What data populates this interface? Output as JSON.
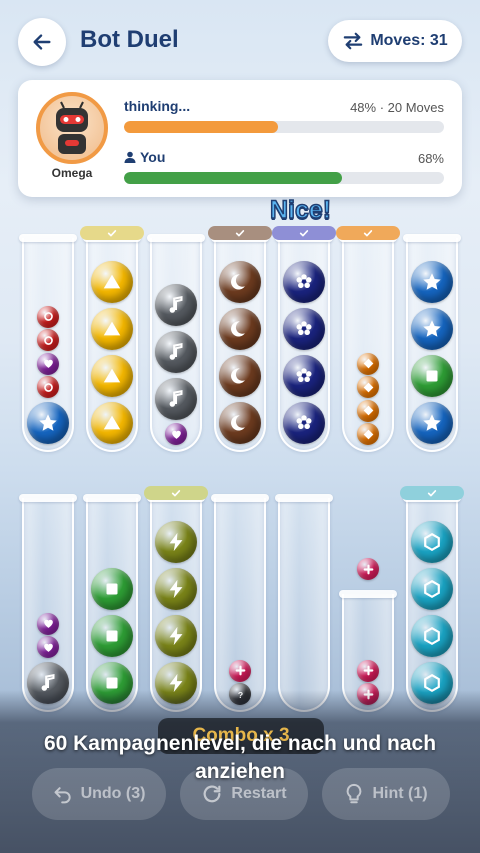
{
  "header": {
    "title": "Bot Duel",
    "moves_label": "Moves: 31"
  },
  "bot": {
    "name": "Omega",
    "status": "thinking...",
    "stats": "48% · 20 Moves",
    "progress": 48,
    "color": "#f39a3c"
  },
  "player": {
    "name": "You",
    "percent_text": "68%",
    "progress": 68,
    "color": "#43a047"
  },
  "feedback": "Nice!",
  "tubes": {
    "row1": [
      {
        "done": false,
        "balls": [
          {
            "c": "#e02020",
            "i": "ring",
            "s": "small"
          },
          {
            "c": "#e02020",
            "i": "ring",
            "s": "small"
          },
          {
            "c": "#8e24aa",
            "i": "heart",
            "s": "small"
          },
          {
            "c": "#e02020",
            "i": "ring",
            "s": "small"
          },
          {
            "c": "#1565c0",
            "i": "star",
            "s": "big"
          }
        ]
      },
      {
        "done": true,
        "cap": "#e6d98a",
        "balls": [
          {
            "c": "#f5b800",
            "i": "triangle",
            "s": "big"
          },
          {
            "c": "#f5b800",
            "i": "triangle",
            "s": "big"
          },
          {
            "c": "#f5b800",
            "i": "triangle",
            "s": "big"
          },
          {
            "c": "#f5b800",
            "i": "triangle",
            "s": "big"
          }
        ]
      },
      {
        "done": false,
        "balls": [
          {
            "c": "#555a60",
            "i": "note",
            "s": "big"
          },
          {
            "c": "#555a60",
            "i": "note",
            "s": "big"
          },
          {
            "c": "#555a60",
            "i": "note",
            "s": "big"
          },
          {
            "c": "#8e24aa",
            "i": "heart",
            "s": "small"
          }
        ]
      },
      {
        "done": true,
        "cap": "#a88f7f",
        "balls": [
          {
            "c": "#6d3b1f",
            "i": "moon",
            "s": "big"
          },
          {
            "c": "#6d3b1f",
            "i": "moon",
            "s": "big"
          },
          {
            "c": "#6d3b1f",
            "i": "moon",
            "s": "big"
          },
          {
            "c": "#6d3b1f",
            "i": "moon",
            "s": "big"
          }
        ]
      },
      {
        "done": true,
        "cap": "#8e8fd6",
        "balls": [
          {
            "c": "#1a237e",
            "i": "flower",
            "s": "big"
          },
          {
            "c": "#1a237e",
            "i": "flower",
            "s": "big"
          },
          {
            "c": "#1a237e",
            "i": "flower",
            "s": "big"
          },
          {
            "c": "#1a237e",
            "i": "flower",
            "s": "big"
          }
        ]
      },
      {
        "done": true,
        "cap": "#f0a95a",
        "balls": [
          {
            "c": "#f57c00",
            "i": "diamond",
            "s": "small"
          },
          {
            "c": "#f57c00",
            "i": "diamond",
            "s": "small"
          },
          {
            "c": "#f57c00",
            "i": "diamond",
            "s": "small"
          },
          {
            "c": "#f57c00",
            "i": "diamond",
            "s": "small"
          }
        ]
      },
      {
        "done": false,
        "balls": [
          {
            "c": "#1565c0",
            "i": "star",
            "s": "big"
          },
          {
            "c": "#1565c0",
            "i": "star",
            "s": "big"
          },
          {
            "c": "#2e9e35",
            "i": "square",
            "s": "big"
          },
          {
            "c": "#1565c0",
            "i": "star",
            "s": "big"
          }
        ]
      }
    ],
    "row2": [
      {
        "done": false,
        "balls": [
          {
            "c": "#8e24aa",
            "i": "heart",
            "s": "small"
          },
          {
            "c": "#8e24aa",
            "i": "heart",
            "s": "small"
          },
          {
            "c": "#555a60",
            "i": "note",
            "s": "big"
          }
        ]
      },
      {
        "done": false,
        "balls": [
          {
            "c": "#2e9e35",
            "i": "square",
            "s": "big"
          },
          {
            "c": "#2e9e35",
            "i": "square",
            "s": "big"
          },
          {
            "c": "#2e9e35",
            "i": "square",
            "s": "big"
          }
        ]
      },
      {
        "done": true,
        "cap": "#cfd58a",
        "balls": [
          {
            "c": "#7a8418",
            "i": "bolt",
            "s": "big"
          },
          {
            "c": "#7a8418",
            "i": "bolt",
            "s": "big"
          },
          {
            "c": "#7a8418",
            "i": "bolt",
            "s": "big"
          },
          {
            "c": "#7a8418",
            "i": "bolt",
            "s": "big"
          }
        ]
      },
      {
        "done": false,
        "balls": [
          {
            "c": "#e91e63",
            "i": "plus",
            "s": "small"
          },
          {
            "c": "#37393d",
            "i": "question",
            "s": "small"
          }
        ]
      },
      {
        "done": false,
        "balls": []
      },
      {
        "done": false,
        "short": true,
        "balls": [
          {
            "c": "#e91e63",
            "i": "plus",
            "s": "small"
          },
          {
            "c": "#e91e63",
            "i": "plus",
            "s": "small"
          }
        ]
      },
      {
        "done": true,
        "cap": "#8fd0dc",
        "balls": [
          {
            "c": "#1aa4c4",
            "i": "hexagon",
            "s": "big"
          },
          {
            "c": "#1aa4c4",
            "i": "hexagon",
            "s": "big"
          },
          {
            "c": "#1aa4c4",
            "i": "hexagon",
            "s": "big"
          },
          {
            "c": "#1aa4c4",
            "i": "hexagon",
            "s": "big"
          }
        ]
      }
    ],
    "floating": {
      "c": "#e91e63",
      "i": "plus",
      "s": "small"
    }
  },
  "combo_label": "Combo x 3",
  "caption": "60 Kampagnenlevel, die nach und nach anziehen",
  "actions": {
    "undo": "Undo (3)",
    "restart": "Restart",
    "hint": "Hint (1)"
  }
}
